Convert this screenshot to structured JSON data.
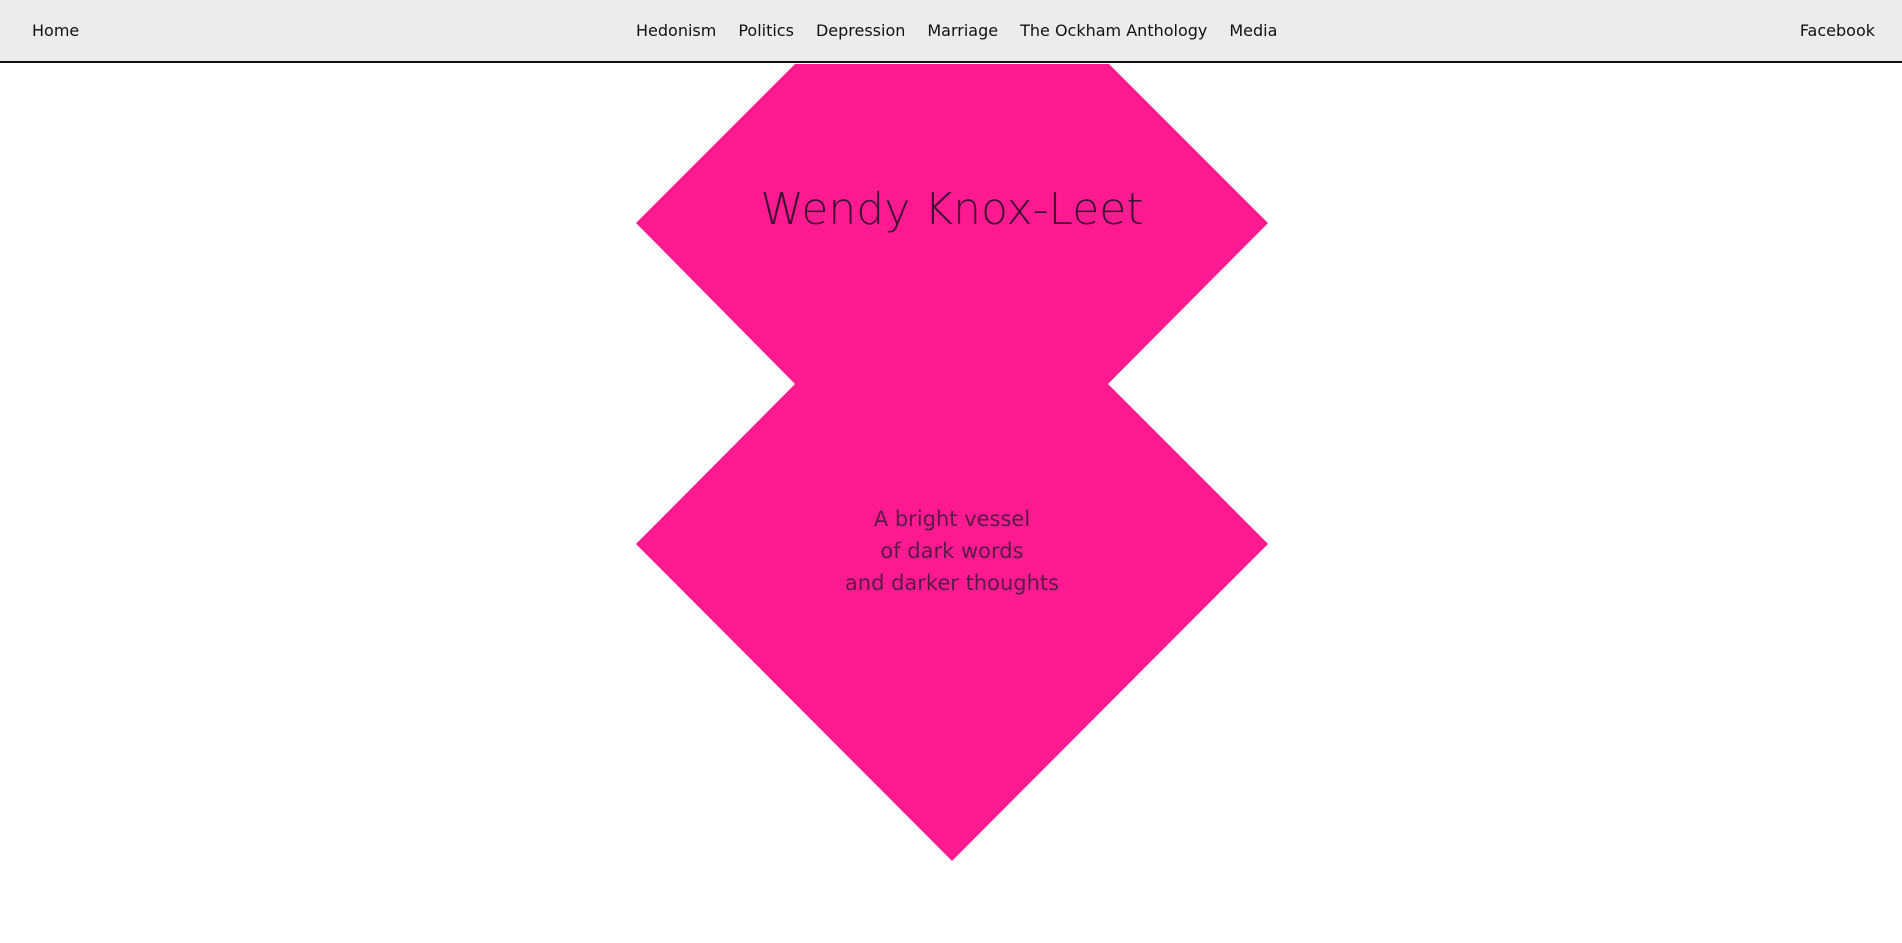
{
  "nav": {
    "home_label": "Home",
    "center_items": [
      {
        "label": "Hedonism"
      },
      {
        "label": "Politics"
      },
      {
        "label": "Depression"
      },
      {
        "label": "Marriage"
      },
      {
        "label": "The Ockham Anthology"
      },
      {
        "label": "Media"
      }
    ],
    "facebook_label": "Facebook"
  },
  "hero": {
    "title": "Wendy Knox-Leet",
    "tagline": [
      "A bright vessel",
      "of dark words",
      "and darker thoughts"
    ],
    "shape_color": "#ff1a92"
  }
}
